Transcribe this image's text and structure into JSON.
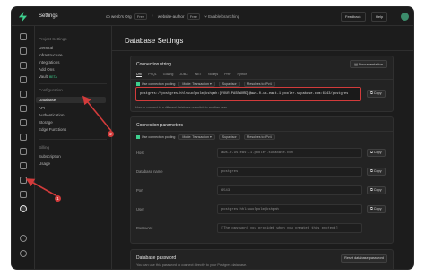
{
  "app": {
    "title": "Settings",
    "org": "cb webb's Org",
    "org_plan": "Free",
    "project": "website-author",
    "project_plan": "Free",
    "branching": "Enable branching",
    "feedback": "Feedback",
    "help": "Help"
  },
  "sidebar": {
    "section_title": "Project Settings",
    "group1": [
      "General",
      "Infrastructure",
      "Integrations",
      "Add Ons"
    ],
    "vault_label": "Vault",
    "vault_badge": "BETA",
    "configuration_head": "Configuration",
    "group2": [
      "Database",
      "API",
      "Authentication",
      "Storage",
      "Edge Functions"
    ],
    "billing_head": "Billing",
    "group3": [
      "Subscription",
      "Usage"
    ]
  },
  "main": {
    "page_title": "Database Settings",
    "connection_string": {
      "title": "Connection string",
      "docs_button": "Documentation",
      "tabs": [
        "URI",
        "PSQL",
        "Golang",
        "JDBC",
        ".NET",
        "Nodejs",
        "PHP",
        "Python"
      ],
      "use_pooling": "Use connection pooling",
      "mode_label": "Mode: Transaction",
      "btn_supavisor": "Supavisor",
      "btn_ipv4": "Resolves to IPv4",
      "uri": "postgres://postgres.hhlzuuolpolmjkshgmh:[YOUR-PASSWORD]@aws-0-us-east-1.pooler.supabase.com:6543/postgres",
      "copy": "Copy",
      "hint": "How to connect to a different database or switch to another user"
    },
    "connection_parameters": {
      "title": "Connection parameters",
      "use_pooling": "Use connection pooling",
      "mode_label": "Mode: Transaction",
      "btn_supavisor": "Supavisor",
      "btn_ipv4": "Resolves to IPv4",
      "rows": [
        {
          "label": "Host",
          "value": "aws-0-us-east-1.pooler.supabase.com",
          "copy": "Copy"
        },
        {
          "label": "Database name",
          "value": "postgres",
          "copy": "Copy"
        },
        {
          "label": "Port",
          "value": "6543",
          "copy": "Copy"
        },
        {
          "label": "User",
          "value": "postgres.hhlzuuolpolmjkshgmh",
          "copy": "Copy"
        },
        {
          "label": "Password",
          "value": "[The password you provided when you created this project]",
          "copy": ""
        }
      ]
    },
    "database_password": {
      "title": "Database password",
      "subtitle": "You can use this password to connect directly to your Postgres database.",
      "reset_button": "Reset database password"
    }
  },
  "annotations": {
    "marker1": "1",
    "marker2": "2"
  },
  "colors": {
    "accent": "#3ecf8e",
    "highlight": "#d23b3b",
    "background": "#1c1c1c"
  }
}
